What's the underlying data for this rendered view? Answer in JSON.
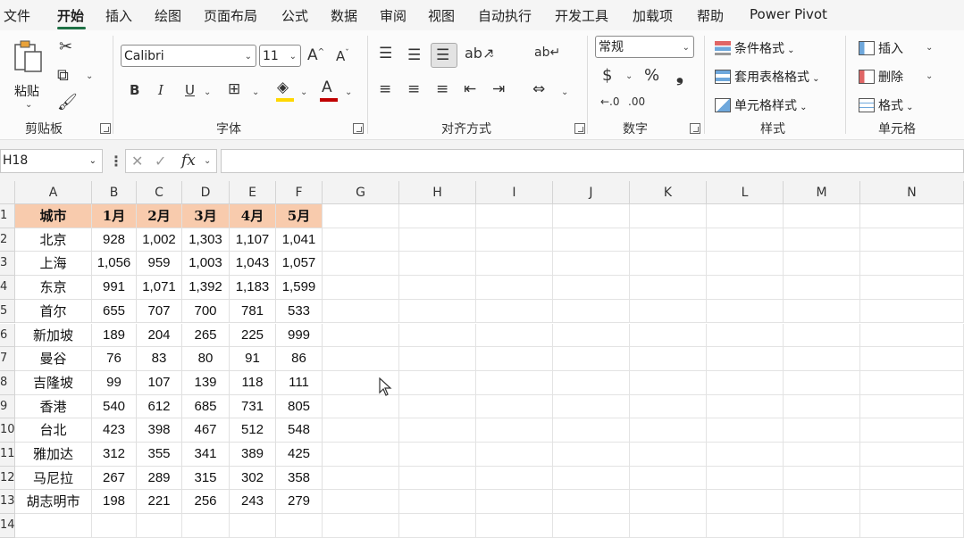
{
  "menu": {
    "tabs": [
      "文件",
      "开始",
      "插入",
      "绘图",
      "页面布局",
      "公式",
      "数据",
      "审阅",
      "视图",
      "自动执行",
      "开发工具",
      "加载项",
      "帮助",
      "Power Pivot"
    ],
    "active": "开始"
  },
  "ribbon": {
    "clipboard": {
      "paste_label": "粘贴",
      "group_label": "剪贴板"
    },
    "font": {
      "font_name": "Calibri",
      "font_size": "11",
      "group_label": "字体",
      "bold": "B",
      "italic": "I",
      "underline": "U"
    },
    "alignment": {
      "group_label": "对齐方式"
    },
    "number": {
      "format": "常规",
      "currency": "$",
      "percent": "%",
      "comma": "❟",
      "group_label": "数字"
    },
    "styles": {
      "conditional": "条件格式",
      "table_format": "套用表格格式",
      "cell_styles": "单元格样式",
      "group_label": "样式"
    },
    "cells": {
      "insert": "插入",
      "delete": "删除",
      "format": "格式",
      "group_label": "单元格"
    }
  },
  "formula_bar": {
    "name_box": "H18",
    "fx": "fx",
    "formula": ""
  },
  "sheet": {
    "columns": [
      "A",
      "B",
      "C",
      "D",
      "E",
      "F",
      "G",
      "H",
      "I",
      "J",
      "K",
      "L",
      "M",
      "N"
    ],
    "row_numbers": [
      "1",
      "2",
      "3",
      "4",
      "5",
      "6",
      "7",
      "8",
      "9",
      "10",
      "11",
      "12",
      "13",
      "14"
    ],
    "header_row": [
      "城市",
      "1月",
      "2月",
      "3月",
      "4月",
      "5月"
    ],
    "rows": [
      [
        "北京",
        "928",
        "1,002",
        "1,303",
        "1,107",
        "1,041"
      ],
      [
        "上海",
        "1,056",
        "959",
        "1,003",
        "1,043",
        "1,057"
      ],
      [
        "东京",
        "991",
        "1,071",
        "1,392",
        "1,183",
        "1,599"
      ],
      [
        "首尔",
        "655",
        "707",
        "700",
        "781",
        "533"
      ],
      [
        "新加坡",
        "189",
        "204",
        "265",
        "225",
        "999"
      ],
      [
        "曼谷",
        "76",
        "83",
        "80",
        "91",
        "86"
      ],
      [
        "吉隆坡",
        "99",
        "107",
        "139",
        "118",
        "111"
      ],
      [
        "香港",
        "540",
        "612",
        "685",
        "731",
        "805"
      ],
      [
        "台北",
        "423",
        "398",
        "467",
        "512",
        "548"
      ],
      [
        "雅加达",
        "312",
        "355",
        "341",
        "389",
        "425"
      ],
      [
        "马尼拉",
        "267",
        "289",
        "315",
        "302",
        "358"
      ],
      [
        "胡志明市",
        "198",
        "221",
        "256",
        "243",
        "279"
      ]
    ],
    "header_fill": "#f8cbad"
  }
}
